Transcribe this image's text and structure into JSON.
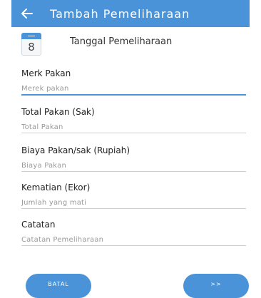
{
  "appbar": {
    "title": "Tambah Pemeliharaan",
    "back_icon": "arrow-left-icon",
    "color": "#4a93d8"
  },
  "date": {
    "icon": "calendar-icon",
    "day": "8",
    "label": "Tanggal Pemeliharaan"
  },
  "fields": [
    {
      "label": "Merk Pakan",
      "placeholder": "Merek pakan"
    },
    {
      "label": "Total Pakan (Sak)",
      "placeholder": "Total Pakan"
    },
    {
      "label": "Biaya Pakan/sak (Rupiah)",
      "placeholder": "Biaya Pakan"
    },
    {
      "label": "Kematian (Ekor)",
      "placeholder": "Jumlah yang mati"
    },
    {
      "label": "Catatan",
      "placeholder": "Catatan Pemeliharaan"
    }
  ],
  "buttons": {
    "cancel_label": "BATAL",
    "next_label": ">>"
  }
}
